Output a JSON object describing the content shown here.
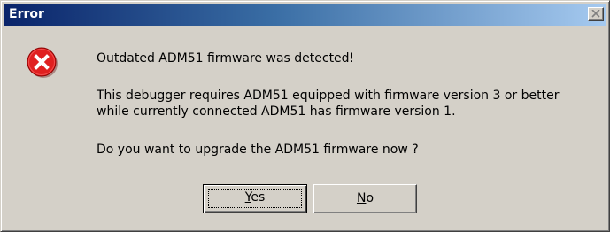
{
  "window": {
    "title": "Error",
    "close_icon": "close-icon"
  },
  "icon": {
    "name": "error-icon",
    "color": "#e02020"
  },
  "message": {
    "line1": "Outdated ADM51 firmware was detected!",
    "line2": "This debugger requires ADM51 equipped with firmware version 3 or better",
    "line3": "while currently connected ADM51 has firmware version 1.",
    "line4": "Do you want to upgrade the ADM51 firmware now ?"
  },
  "buttons": {
    "yes": {
      "mnemonic": "Y",
      "rest": "es"
    },
    "no": {
      "mnemonic": "N",
      "rest": "o"
    }
  }
}
